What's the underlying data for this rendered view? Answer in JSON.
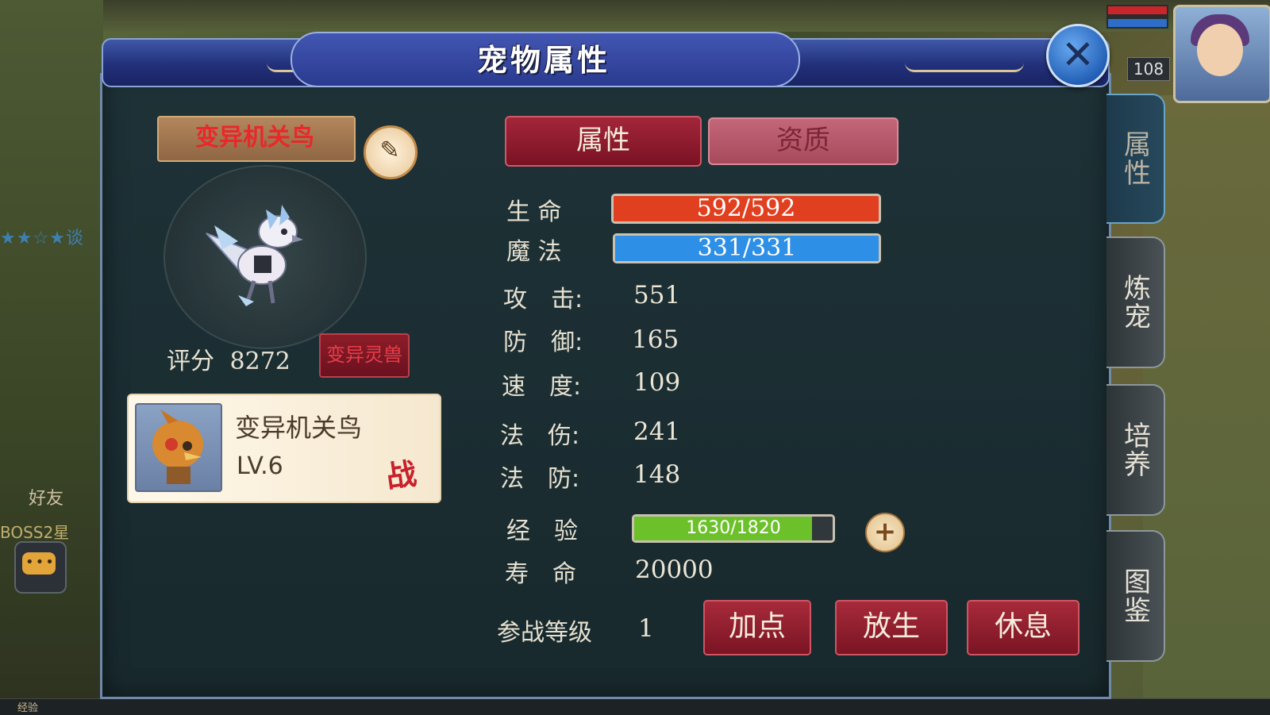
{
  "window": {
    "title": "宠物属性"
  },
  "pet": {
    "name_plate": "变异机关鸟",
    "score_label": "评分",
    "score_value": "8272",
    "mutant_button": "变异灵兽",
    "card_name": "变异机关鸟",
    "card_level": "LV.6",
    "battle_badge": "战"
  },
  "tabs": {
    "attributes": "属性",
    "aptitude": "资质"
  },
  "side_tabs": [
    {
      "label": "属性",
      "active": true
    },
    {
      "label": "炼宠",
      "active": false
    },
    {
      "label": "培养",
      "active": false
    },
    {
      "label": "图鉴",
      "active": false
    }
  ],
  "stats": {
    "hp_label": "生 命",
    "hp_text": "592/592",
    "hp_fraction": 1.0,
    "mp_label": "魔 法",
    "mp_text": "331/331",
    "mp_fraction": 1.0,
    "attack_label": "攻　击:",
    "attack_value": "551",
    "defense_label": "防　御:",
    "defense_value": "165",
    "speed_label": "速　度:",
    "speed_value": "109",
    "magic_dmg_label": "法　伤:",
    "magic_dmg_value": "241",
    "magic_def_label": "法　防:",
    "magic_def_value": "148",
    "exp_label": "经　验",
    "exp_text": "1630/1820",
    "exp_fraction": 0.8956,
    "life_label": "寿　命",
    "life_value": "20000",
    "battle_level_label": "参战等级",
    "battle_level_value": "1"
  },
  "actions": {
    "add_points": "加点",
    "release": "放生",
    "rest": "休息"
  },
  "background": {
    "player_level": "108",
    "friend_label": "好友",
    "boss_label": "BOSS2星",
    "bottom_label": "经验",
    "star_row": "★★☆★谈"
  },
  "colors": {
    "hp_fill": "#e0401f",
    "mp_fill": "#2e8fe6",
    "exp_fill": "#6cc12b",
    "accent_red": "#a72a3a",
    "panel_bg": "#1e3237"
  },
  "icons": {
    "close": "close-icon",
    "edit": "edit-icon",
    "plus": "plus-icon",
    "chat": "chat-icon"
  }
}
